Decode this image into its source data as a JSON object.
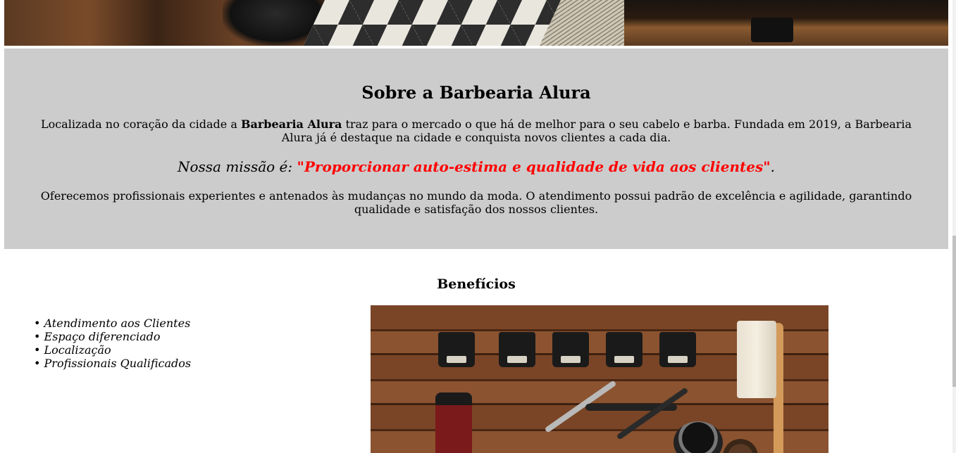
{
  "about": {
    "title": "Sobre a Barbearia Alura",
    "p1_before": "Localizada no coração da cidade a ",
    "p1_bold": "Barbearia Alura",
    "p1_after": " traz para o mercado o que há de melhor para o seu cabelo e barba. Fundada em 2019, a Barbearia Alura já é destaque na cidade e conquista novos clientes a cada dia.",
    "mission_label": "Nossa missão é: ",
    "mission_quote": "\"Proporcionar auto-estima e qualidade de vida aos clientes\"",
    "mission_end": ".",
    "p2": "Oferecemos profissionais experientes e antenados às mudanças no mundo da moda. O atendimento possui padrão de excelência e agilidade, garantindo qualidade e satisfação dos nossos clientes.",
    "mission_color": "#ff0000",
    "background": "#cccccc"
  },
  "benefits": {
    "title": "Benefícios",
    "items": [
      "Atendimento aos Clientes",
      "Espaço diferenciado",
      "Localização",
      "Profissionais Qualificados"
    ]
  }
}
